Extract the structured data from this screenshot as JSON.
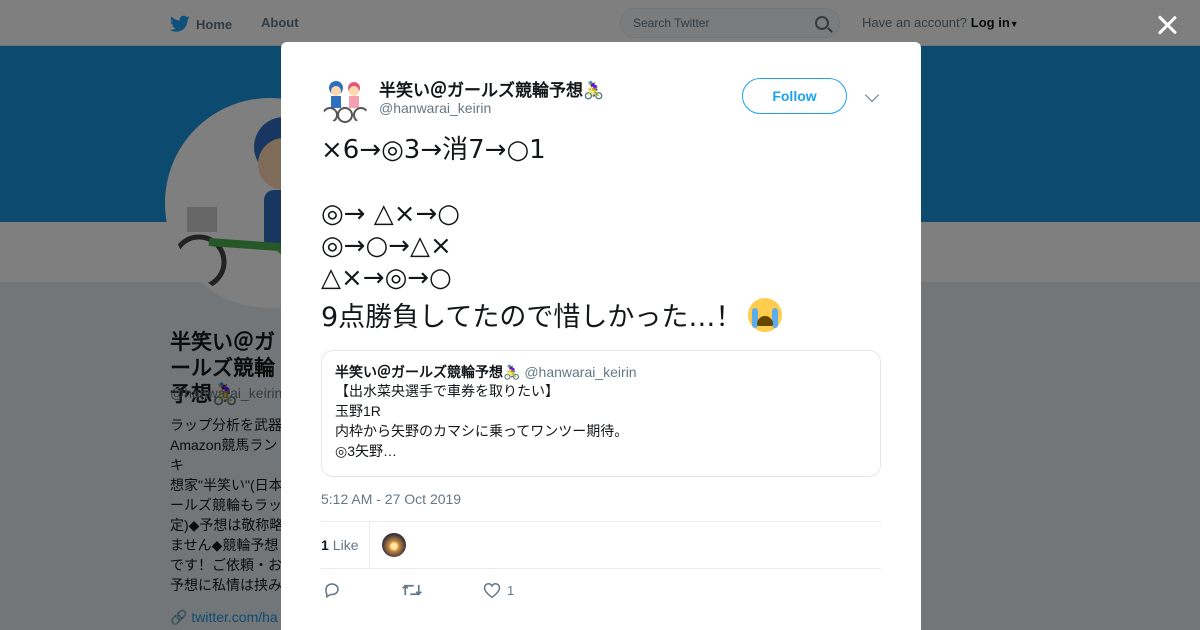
{
  "background": {
    "nav": {
      "home": "Home",
      "about": "About"
    },
    "search": {
      "placeholder": "Search Twitter"
    },
    "account": {
      "prompt": "Have an account?",
      "login": "Log in"
    },
    "profile": {
      "name": "半笑い＠ガールズ競輪予想🚴‍♀️",
      "handle": "@hanwarai_keirin",
      "bio": "ラップ分析を武器\nAmazon競馬ランキ\n想家\"半笑い\"(日本\nールズ競輪もラッ\n定)◆予想は敬称略\nません◆競輪予想\nです！ご依頼・お\n予想に私情は挟み\n選手神推しです😊",
      "link": "twitter.com/ha"
    }
  },
  "tweet": {
    "author_name": "半笑い＠ガールズ競輪予想🚴‍♀️",
    "author_handle": "@hanwarai_keirin",
    "follow_label": "Follow",
    "lines": [
      "×6→◎3→消7→○1",
      "",
      "◎→ △×→○",
      "◎→○→△×",
      "△×→◎→○",
      "9点勝負してたので惜しかった…！"
    ],
    "timestamp": "5:12 AM - 27 Oct 2019",
    "like_count": "1",
    "like_label": "Like",
    "action_like_count": "1"
  },
  "quote": {
    "name": "半笑い＠ガールズ競輪予想🚴‍♀️",
    "handle": "@hanwarai_keirin",
    "lines": [
      "【出水菜央選手で車券を取りたい】",
      "玉野1R",
      "内枠から矢野のカマシに乗ってワンツー期待。",
      "◎3矢野…"
    ]
  },
  "colors": {
    "accent": "#1da1f2",
    "banner": "#1b95e0",
    "muted": "#657786"
  }
}
